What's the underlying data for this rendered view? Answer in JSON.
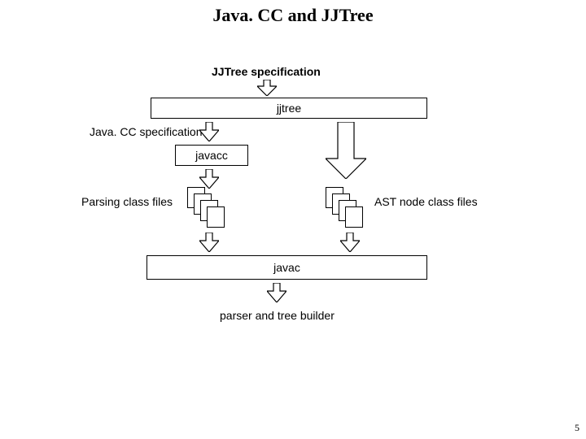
{
  "title": "Java. CC and JJTree",
  "labels": {
    "jjtree_spec": "JJTree specification",
    "javacc_spec": "Java. CC specification",
    "parsing_class_files": "Parsing class files",
    "ast_node_class_files": "AST node class files",
    "parser_tree_builder": "parser and tree builder"
  },
  "boxes": {
    "jjtree": "jjtree",
    "javacc": "javacc",
    "javac": "javac"
  },
  "page_number": "5"
}
